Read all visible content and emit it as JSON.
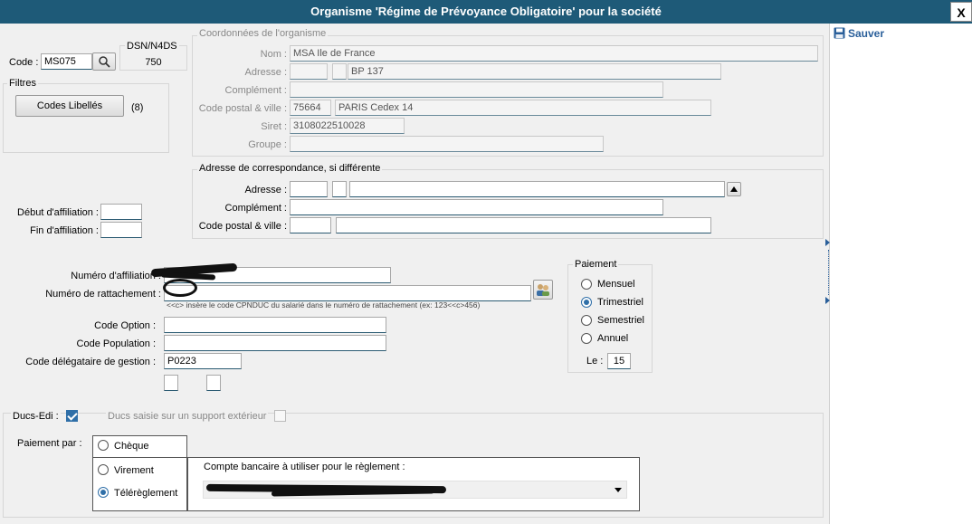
{
  "window": {
    "title": "Organisme 'Régime de Prévoyance Obligatoire' pour la société",
    "close_label": "X"
  },
  "toolbar": {
    "save_label": "Sauver"
  },
  "code": {
    "label": "Code :",
    "value": "MS075"
  },
  "dsn": {
    "label": "DSN/N4DS",
    "value": "750"
  },
  "filters": {
    "legend": "Filtres",
    "button_label": "Codes Libellés",
    "count": "(8)"
  },
  "organisme": {
    "legend": "Coordonnées de l'organisme",
    "nom_label": "Nom :",
    "nom": "MSA Ile de France",
    "adresse_label": "Adresse :",
    "adresse_num": "",
    "adresse_type": "",
    "adresse": "BP 137",
    "complement_label": "Complément :",
    "complement": "",
    "cp_label": "Code postal & ville :",
    "cp": "75664",
    "ville": "PARIS Cedex 14",
    "siret_label": "Siret :",
    "siret": "3108022510028",
    "groupe_label": "Groupe :",
    "groupe": ""
  },
  "correspondance": {
    "legend": "Adresse de correspondance, si différente",
    "adresse_label": "Adresse :",
    "complement_label": "Complément :",
    "cp_label": "Code postal & ville :"
  },
  "affiliation": {
    "debut_label": "Début d'affiliation :",
    "fin_label": "Fin d'affiliation :",
    "debut": "",
    "fin": ""
  },
  "numeros": {
    "affiliation_label": "Numéro d'affiliation :",
    "rattachement_label": "Numéro de rattachement :",
    "hint": "<<c> insère le code CPNDUC du salarié dans le numéro de rattachement (ex: 123<<c>456)",
    "option_label": "Code Option :",
    "population_label": "Code Population :",
    "delegataire_label": "Code délégataire de gestion :",
    "delegataire": "P0223"
  },
  "paiement": {
    "legend": "Paiement",
    "options": [
      "Mensuel",
      "Trimestriel",
      "Semestriel",
      "Annuel"
    ],
    "selected": "Trimestriel",
    "le_label": "Le :",
    "le_value": "15"
  },
  "ducs": {
    "label": "Ducs-Edi :",
    "exterieur_label": "Ducs saisie sur un support extérieur"
  },
  "paiement_par": {
    "label": "Paiement par :",
    "options": [
      "Chèque",
      "Virement",
      "Télérèglement"
    ],
    "selected": "Télérèglement",
    "compte_label": "Compte bancaire à utiliser pour le règlement :"
  },
  "colors": {
    "titlebar": "#1e5a78",
    "accent": "#2f6fa8"
  },
  "icons": {
    "search": "search-icon",
    "save": "floppy-disk-icon",
    "people": "people-icon",
    "scroll_up": "arrow-up-icon",
    "dropdown": "chevron-down-icon"
  }
}
